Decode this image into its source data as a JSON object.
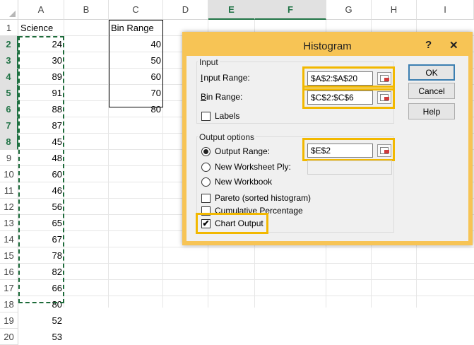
{
  "columns": [
    "A",
    "B",
    "C",
    "D",
    "E",
    "F",
    "G",
    "H",
    "I"
  ],
  "rows": [
    "1",
    "2",
    "3",
    "4",
    "5",
    "6",
    "7",
    "8",
    "9",
    "10",
    "11",
    "12",
    "13",
    "14",
    "15",
    "16",
    "17",
    "18",
    "19",
    "20"
  ],
  "columnA": {
    "header": "Science",
    "values": [
      "24",
      "30",
      "89",
      "91",
      "88",
      "87",
      "45",
      "48",
      "60",
      "46",
      "56",
      "65",
      "67",
      "78",
      "82",
      "66",
      "80",
      "52",
      "53"
    ]
  },
  "columnC": {
    "header": "Bin Range",
    "values": [
      "40",
      "50",
      "60",
      "70",
      "80"
    ]
  },
  "dialog": {
    "title": "Histogram",
    "help_symbol": "?",
    "close_symbol": "✕",
    "input_group": "Input",
    "input_range_label": "Input Range:",
    "input_range_value": "$A$2:$A$20",
    "bin_range_label": "Bin Range:",
    "bin_range_value": "$C$2:$C$6",
    "labels": "Labels",
    "output_group": "Output options",
    "output_range_label": "Output Range:",
    "output_range_value": "$E$2",
    "new_worksheet_label": "New Worksheet Ply:",
    "new_workbook_label": "New Workbook",
    "pareto_label": "Pareto (sorted histogram)",
    "cumulative_label": "Cumulative Percentage",
    "chart_output_label": "Chart Output",
    "ok": "OK",
    "cancel": "Cancel",
    "help": "Help",
    "check_mark": "✔"
  },
  "colors": {
    "highlight": "#f2b800",
    "titlebar": "#f7c455",
    "excel_green": "#217346"
  }
}
